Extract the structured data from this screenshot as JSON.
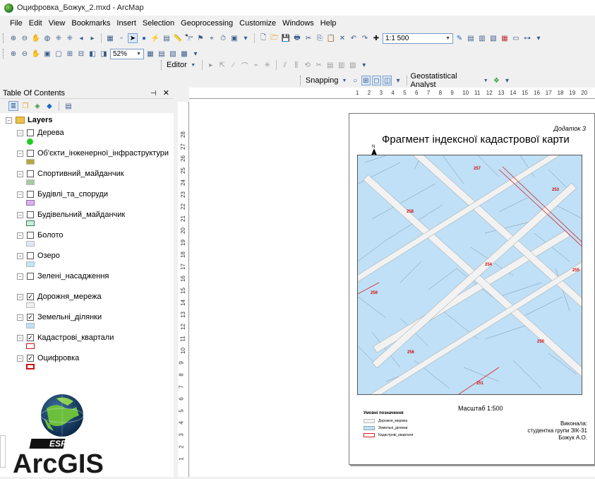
{
  "window": {
    "title": "Оцифровка_Божук_2.mxd - ArcMap"
  },
  "menu": [
    "File",
    "Edit",
    "View",
    "Bookmarks",
    "Insert",
    "Selection",
    "Geoprocessing",
    "Customize",
    "Windows",
    "Help"
  ],
  "toolbar": {
    "scale": "1:1 500",
    "zoom": "52%",
    "editor_label": "Editor",
    "snapping_label": "Snapping",
    "geostat_label": "Geostatistical Analyst"
  },
  "toc": {
    "title": "Table Of Contents",
    "root": "Layers",
    "layers": [
      {
        "name": "Дерева",
        "checked": false,
        "swatch": "#22cc22"
      },
      {
        "name": "Об'єкти_інженерної_інфраструктури",
        "checked": false,
        "swatch": "#b5a83c"
      },
      {
        "name": "Спортивний_майданчик",
        "checked": false,
        "swatch": "#a8cba0"
      },
      {
        "name": "Будівлі_та_споруди",
        "checked": false,
        "swatch": "#d8b4e8"
      },
      {
        "name": "Будівельний_майданчик",
        "checked": false,
        "swatch": "#c8eed8"
      },
      {
        "name": "Болото",
        "checked": false,
        "swatch": "#dfe6f8"
      },
      {
        "name": "Озеро",
        "checked": false,
        "swatch": "#c0e4f4"
      },
      {
        "name": "Зелені_насадження",
        "checked": false,
        "swatch": ""
      },
      {
        "name": "Дорожня_мережа",
        "checked": true,
        "swatch": "#f0f0f0"
      },
      {
        "name": "Земельні_ділянки",
        "checked": true,
        "swatch": "#bfe0f6"
      },
      {
        "name": "Кадастрові_квартали",
        "checked": true,
        "swatch": "#ffffff"
      },
      {
        "name": "Оцифровка",
        "checked": true,
        "swatch": "#ffffff"
      }
    ]
  },
  "layout": {
    "annex": "Додаток 3",
    "title": "Фрагмент індексної кадастрової карти",
    "scale_text": "Масштаб 1:500",
    "legend_title": "Умовні позначення",
    "legend_items": [
      "Дорожня_мережа",
      "Земельні_ділянки",
      "Кадастрові_квартали"
    ],
    "executor": "Виконала:",
    "group": "студентка групи ЗІК-31",
    "author": "Божук А.О.",
    "quarter_labels": [
      "257",
      "253",
      "258",
      "254",
      "255",
      "259",
      "256",
      "251",
      "250"
    ]
  },
  "ruler": {
    "h": [
      "1",
      "2",
      "3",
      "4",
      "5",
      "6",
      "7",
      "8",
      "9",
      "10",
      "11",
      "12",
      "13",
      "14",
      "15",
      "16",
      "17",
      "18",
      "19",
      "20"
    ],
    "v": [
      "28",
      "27",
      "26",
      "25",
      "24",
      "23",
      "22",
      "21",
      "20",
      "19",
      "18",
      "17",
      "16",
      "15",
      "14",
      "13",
      "12",
      "11",
      "10",
      "9",
      "8",
      "7",
      "6",
      "5",
      "4",
      "3",
      "2",
      "1"
    ]
  },
  "logo": {
    "brand": "ESRI",
    "product": "ArcGIS"
  }
}
